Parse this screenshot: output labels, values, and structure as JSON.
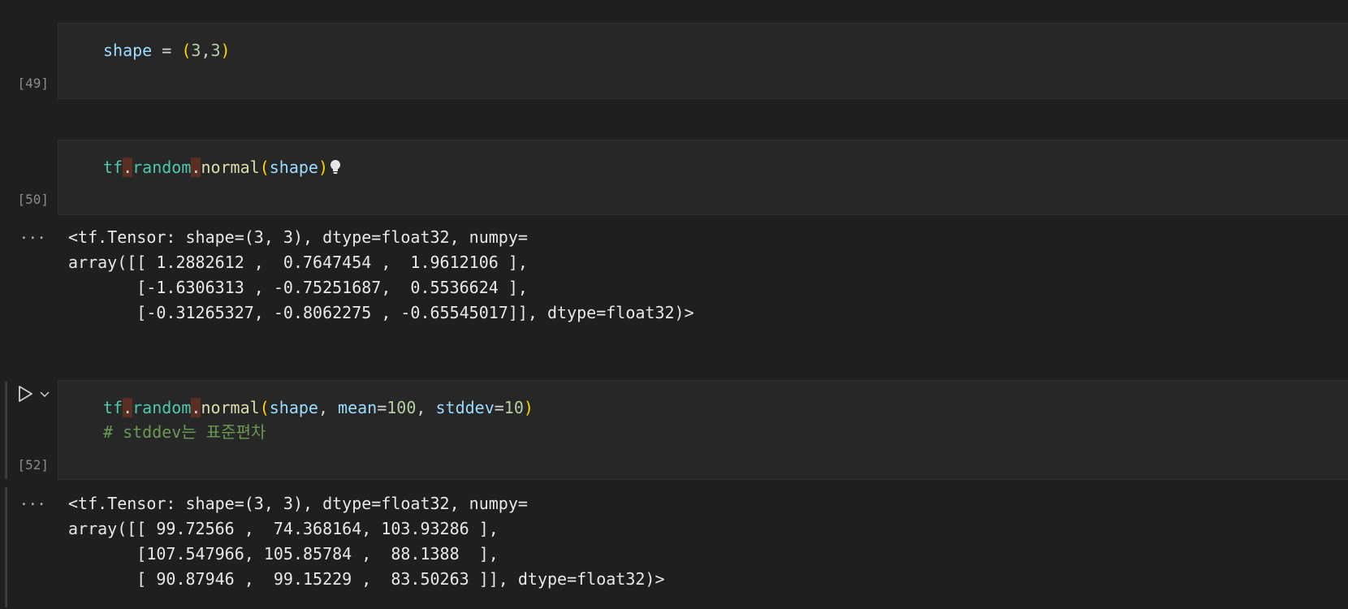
{
  "cells": [
    {
      "exec_count": "[49]",
      "code": {
        "line1": {
          "name": "shape",
          "eq": " = ",
          "open": "(",
          "n1": "3",
          "comma": ",",
          "n2": "3",
          "close": ")"
        }
      }
    },
    {
      "exec_count": "[50]",
      "code": {
        "line1": {
          "tf": "tf",
          "dot1": ".",
          "random": "random",
          "dot2": ".",
          "normal": "normal",
          "open": "(",
          "arg": "shape",
          "close": ")"
        }
      },
      "lightbulb_icon": "lightbulb-icon",
      "output": {
        "ellipsis": "···",
        "lines": [
          "<tf.Tensor: shape=(3, 3), dtype=float32, numpy=",
          "array([[ 1.2882612 ,  0.7647454 ,  1.9612106 ],",
          "       [-1.6306313 , -0.75251687,  0.5536624 ],",
          "       [-0.31265327, -0.8062275 , -0.65545017]], dtype=float32)>"
        ]
      }
    },
    {
      "exec_count": "[52]",
      "run_icon": "run-icon",
      "chevron_icon": "chevron-down-icon",
      "code": {
        "line1": {
          "tf": "tf",
          "dot1": ".",
          "random": "random",
          "dot2": ".",
          "normal": "normal",
          "open": "(",
          "arg": "shape",
          "c1": ", ",
          "k1": "mean",
          "e1": "=",
          "v1": "100",
          "c2": ", ",
          "k2": "stddev",
          "e2": "=",
          "v2": "10",
          "close": ")"
        },
        "line2": "# stddev는 표준편차"
      },
      "output": {
        "ellipsis": "···",
        "lines": [
          "<tf.Tensor: shape=(3, 3), dtype=float32, numpy=",
          "array([[ 99.72566 ,  74.368164, 103.93286 ],",
          "       [107.547966, 105.85784 ,  88.1388  ],",
          "       [ 90.87946 ,  99.15229 ,  83.50263 ]], dtype=float32)>"
        ]
      }
    }
  ],
  "colors": {
    "background": "#1f1f1f",
    "cell": "#272727",
    "variable": "#9cdcfe",
    "module": "#4ec9b0",
    "function": "#dcdcaa",
    "bracket": "#ffd700",
    "number": "#b5cea8",
    "comment": "#6a9955",
    "highlight": "#5a2e22"
  }
}
